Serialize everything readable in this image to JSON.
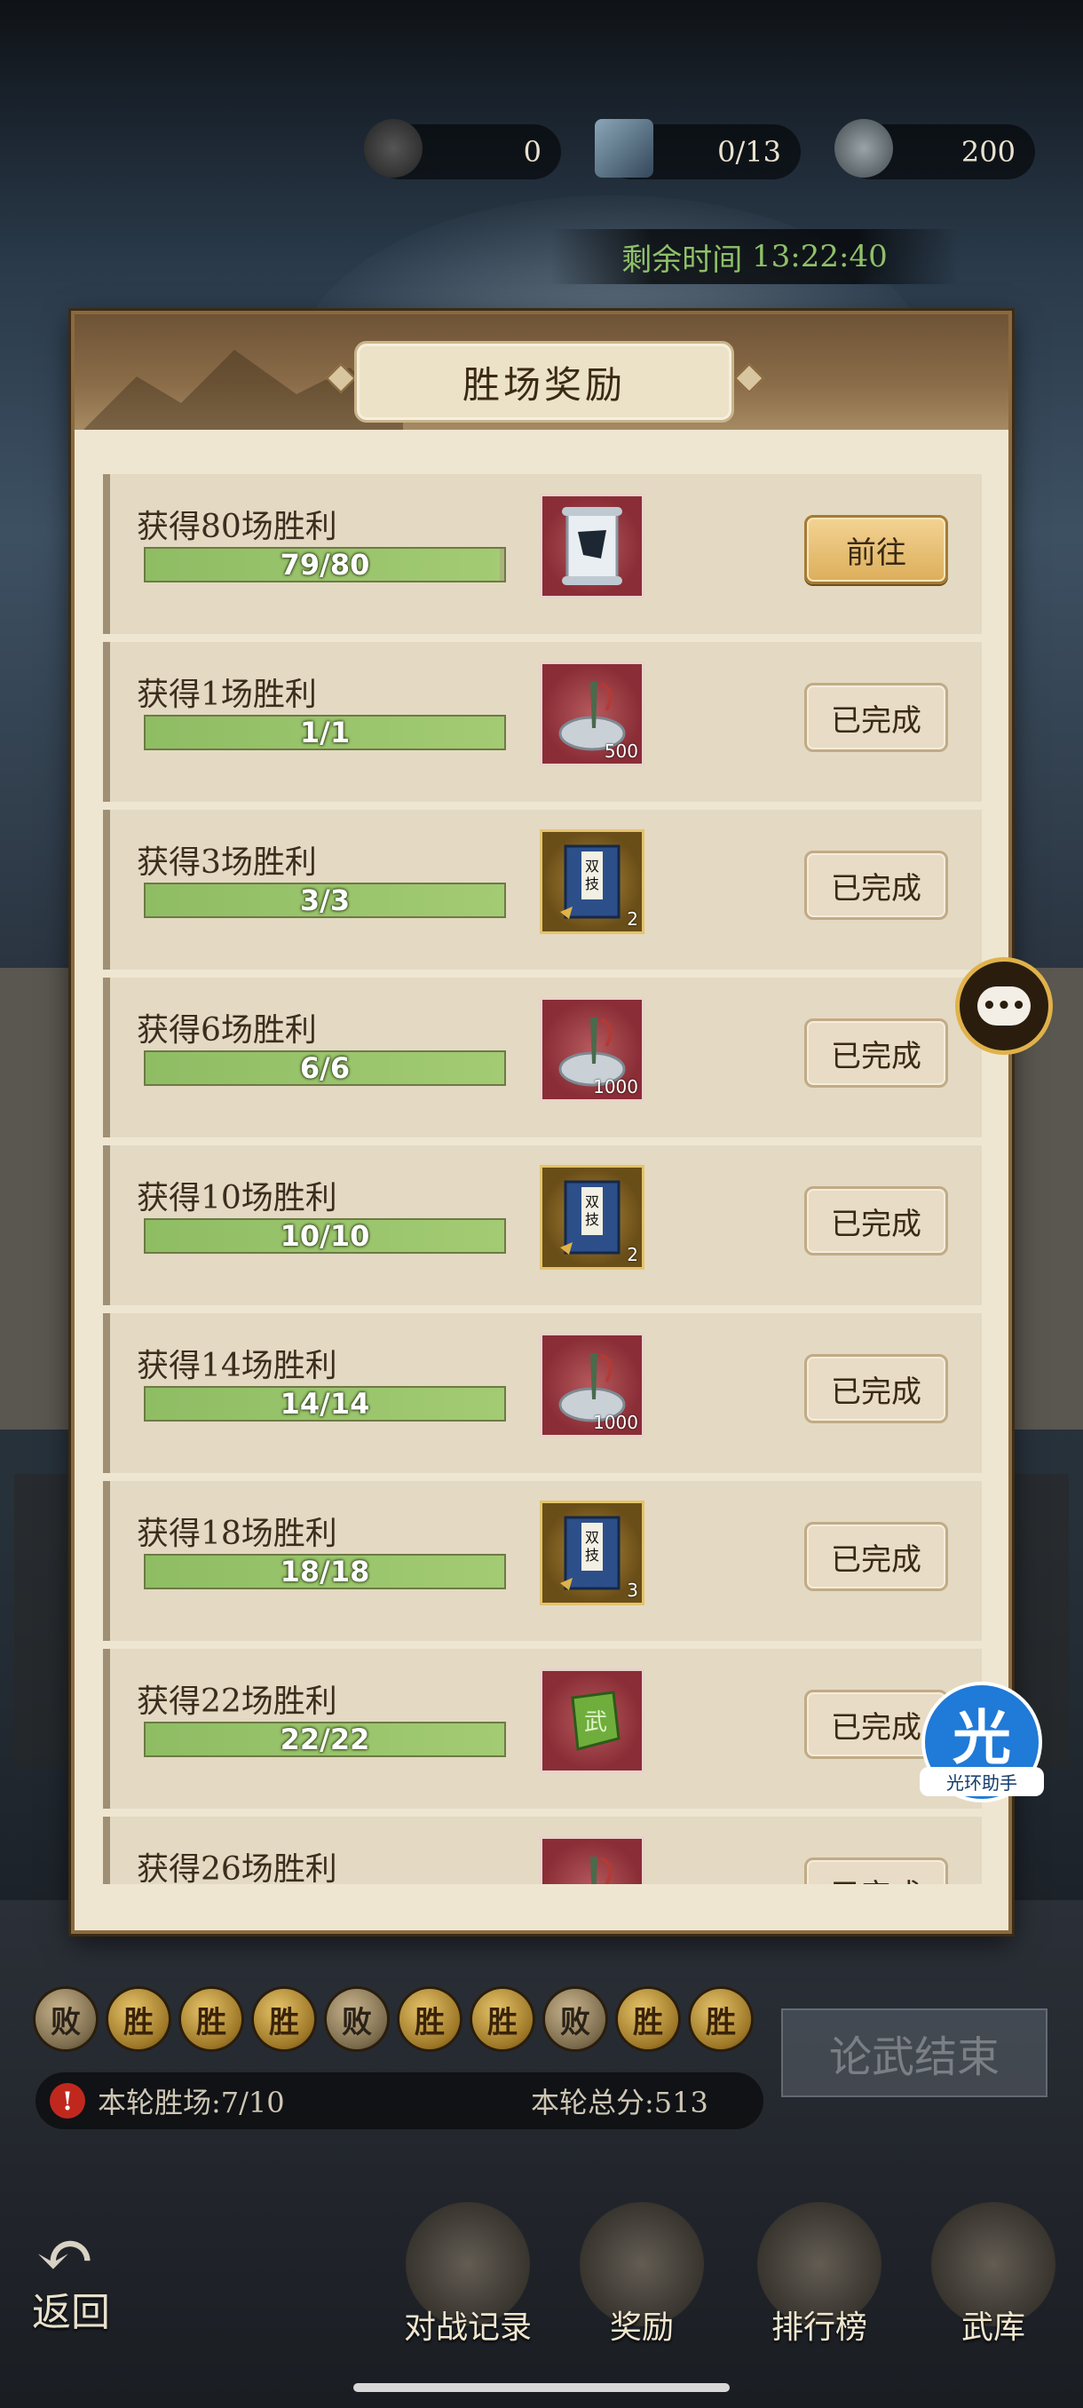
{
  "top_stats": {
    "coins": "0",
    "progress": "0/13",
    "stamina": "200"
  },
  "timer": {
    "label": "剩余时间",
    "value": "13:22:40"
  },
  "dialog": {
    "title": "胜场奖励",
    "rows": [
      {
        "name": "获得80场胜利",
        "progress": "79/80",
        "fraction": 0.9875,
        "item": "scroll",
        "frame": "red",
        "qty": "",
        "button": "前往",
        "state": "go"
      },
      {
        "name": "获得1场胜利",
        "progress": "1/1",
        "fraction": 1,
        "item": "silver-ingot",
        "frame": "red",
        "qty": "500",
        "button": "已完成",
        "state": "done"
      },
      {
        "name": "获得3场胜利",
        "progress": "3/3",
        "fraction": 1,
        "item": "manual-book",
        "frame": "gold",
        "qty": "2",
        "button": "已完成",
        "state": "done"
      },
      {
        "name": "获得6场胜利",
        "progress": "6/6",
        "fraction": 1,
        "item": "silver-ingot",
        "frame": "red",
        "qty": "1000",
        "button": "已完成",
        "state": "done"
      },
      {
        "name": "获得10场胜利",
        "progress": "10/10",
        "fraction": 1,
        "item": "manual-book",
        "frame": "gold",
        "qty": "2",
        "button": "已完成",
        "state": "done"
      },
      {
        "name": "获得14场胜利",
        "progress": "14/14",
        "fraction": 1,
        "item": "silver-ingot",
        "frame": "red",
        "qty": "1000",
        "button": "已完成",
        "state": "done"
      },
      {
        "name": "获得18场胜利",
        "progress": "18/18",
        "fraction": 1,
        "item": "manual-book",
        "frame": "gold",
        "qty": "3",
        "button": "已完成",
        "state": "done"
      },
      {
        "name": "获得22场胜利",
        "progress": "22/22",
        "fraction": 1,
        "item": "jade-token",
        "frame": "red",
        "qty": "",
        "button": "已完成",
        "state": "done"
      },
      {
        "name": "获得26场胜利",
        "progress": "",
        "fraction": 1,
        "item": "silver-ingot",
        "frame": "red",
        "qty": "",
        "button": "已完成",
        "state": "done"
      }
    ]
  },
  "results": [
    "败",
    "胜",
    "胜",
    "胜",
    "败",
    "胜",
    "胜",
    "败",
    "胜",
    "胜"
  ],
  "end_button": "论武结束",
  "round_stats": {
    "wins": "本轮胜场:7/10",
    "score": "本轮总分:513"
  },
  "nav": {
    "back": "返回",
    "items": [
      "对战记录",
      "奖励",
      "排行榜",
      "武库"
    ]
  },
  "assistant": {
    "glyph": "光",
    "label": "光环助手"
  },
  "colors": {
    "progress_green": "#9cc86d",
    "go_button": "#e4b968",
    "dialog_bg": "#efe6d2",
    "timer_text": "#8fc069"
  }
}
